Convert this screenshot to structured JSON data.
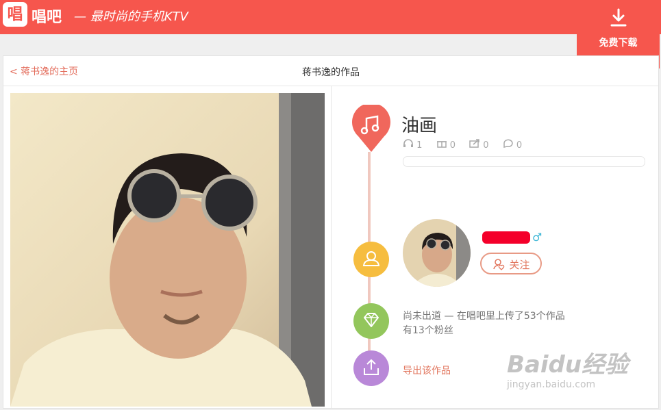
{
  "header": {
    "logo_icon_text": "唱",
    "logo_text": "唱吧",
    "slogan": "— 最时尚的手机KTV",
    "download_label": "免费下载"
  },
  "nav": {
    "back_label": "< 蒋书逸的主页",
    "page_title": "蒋书逸的作品"
  },
  "song": {
    "title": "油画",
    "listens": "1",
    "gifts": "0",
    "shares": "0",
    "comments": "0"
  },
  "user": {
    "gender_symbol": "♂",
    "follow_label": "关注"
  },
  "info": {
    "line1": "尚未出道 — 在唱吧里上传了53个作品",
    "line2": "有13个粉丝"
  },
  "export": {
    "label": "导出该作品"
  },
  "watermark": {
    "line1": "Baidu经验",
    "line2": "jingyan.baidu.com"
  },
  "colors": {
    "brand": "#f6564d",
    "music": "#f0675c",
    "user": "#f6bd3f",
    "diamond": "#93c65c",
    "export": "#b988d8"
  }
}
